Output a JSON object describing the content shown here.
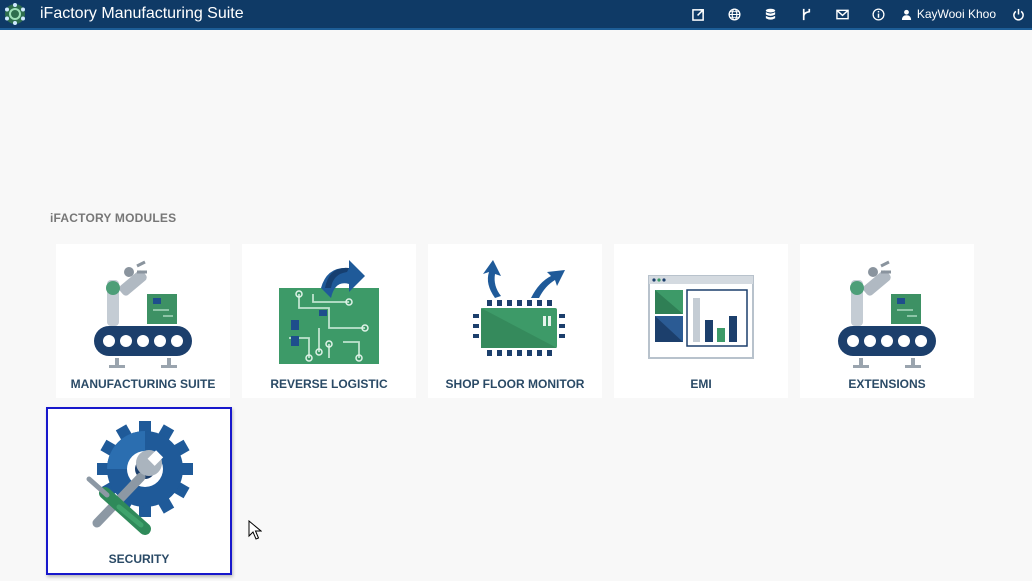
{
  "app": {
    "title": "iFactory Manufacturing Suite"
  },
  "header": {
    "icons": [
      "external-link-icon",
      "globe-icon",
      "database-icon",
      "branch-icon",
      "mail-icon",
      "info-icon"
    ],
    "user_name": "KayWooi Khoo",
    "accent": "#0f3a66"
  },
  "section": {
    "title": "iFACTORY MODULES"
  },
  "modules": [
    {
      "label": "MANUFACTURING SUITE",
      "icon": "robot-arm-conveyor-icon"
    },
    {
      "label": "REVERSE LOGISTIC",
      "icon": "circuit-board-return-icon"
    },
    {
      "label": "SHOP FLOOR MONITOR",
      "icon": "chip-icon"
    },
    {
      "label": "EMI",
      "icon": "dashboard-chart-icon"
    },
    {
      "label": "EXTENSIONS",
      "icon": "robot-arm-conveyor-icon"
    },
    {
      "label": "SECURITY",
      "icon": "gear-tools-icon",
      "selected": true
    }
  ]
}
